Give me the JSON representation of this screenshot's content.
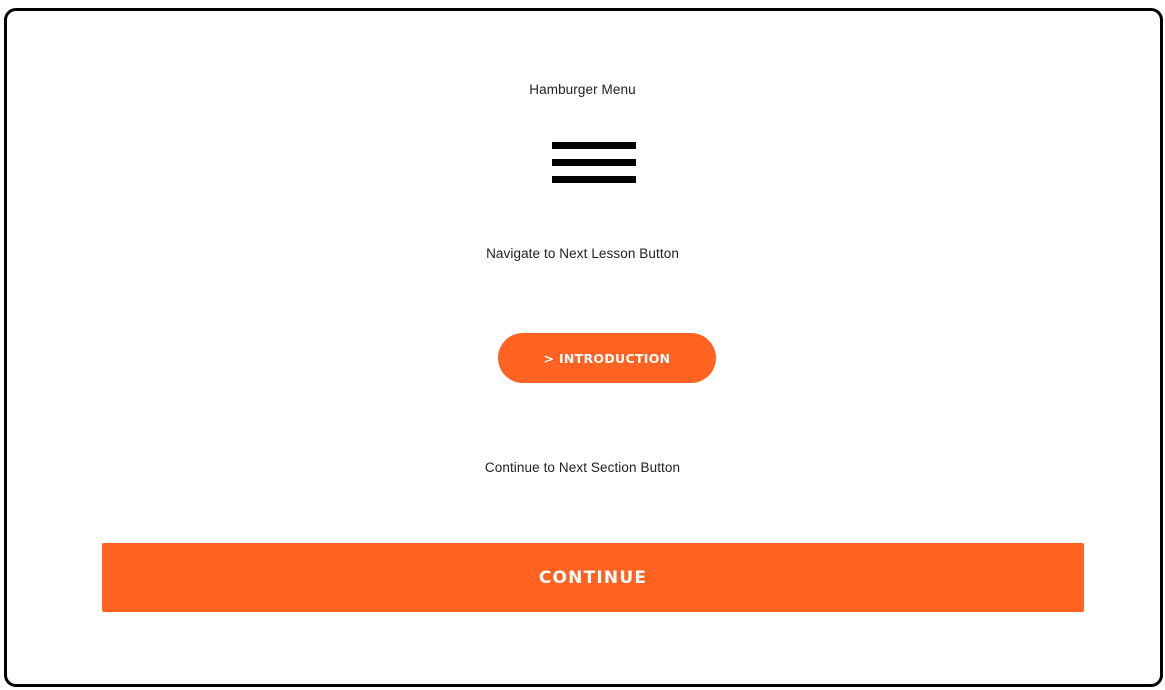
{
  "captions": {
    "hamburger_menu": "Hamburger Menu",
    "next_lesson": "Navigate to Next Lesson Button",
    "next_section": "Continue to Next Section Button"
  },
  "hamburger": {
    "icon": "hamburger-menu-icon"
  },
  "lesson_button": {
    "label": "> INTRODUCTION"
  },
  "continue_button": {
    "label": "CONTINUE"
  },
  "colors": {
    "accent": "#ff6221",
    "frame_border": "#000000",
    "background": "#ffffff"
  }
}
